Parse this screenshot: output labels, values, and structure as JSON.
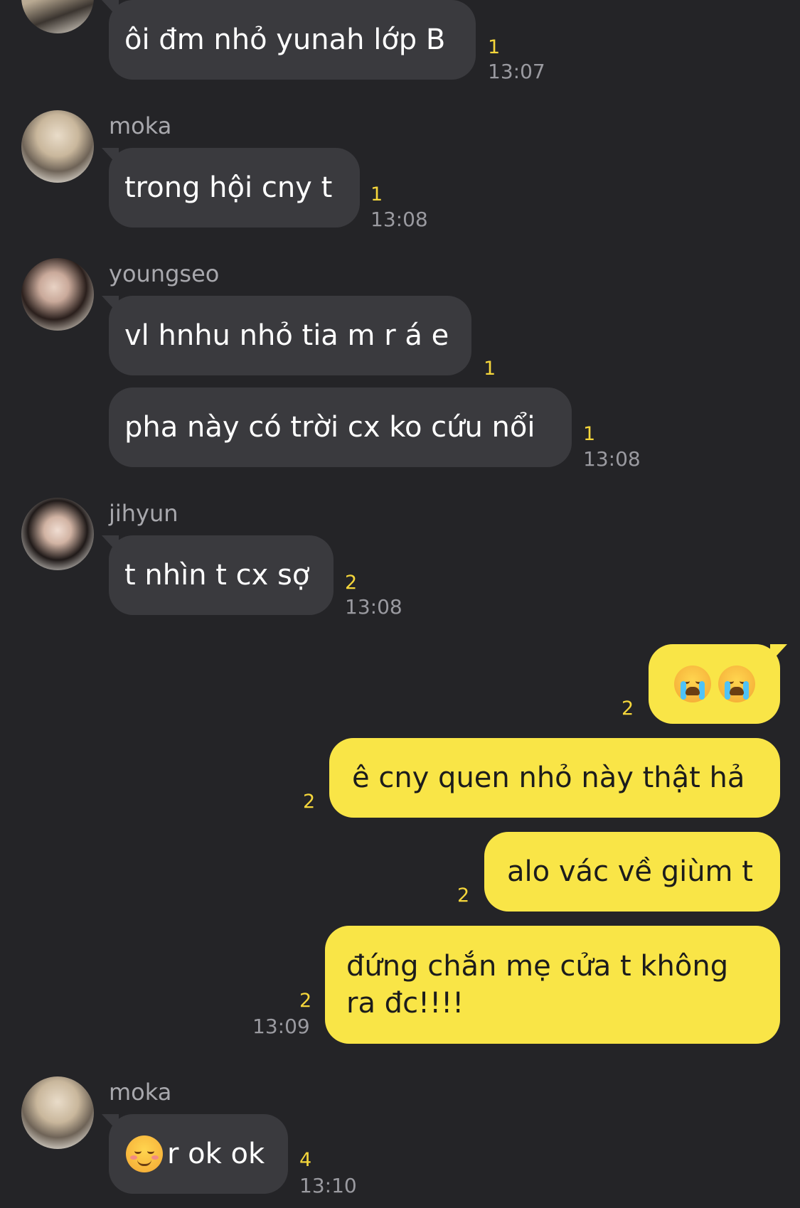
{
  "messages": [
    {
      "sender": "",
      "text": "ôi đm nhỏ yunah lớp B",
      "count": "1",
      "time": "13:07"
    },
    {
      "sender": "moka",
      "text": "trong hội cny t",
      "count": "1",
      "time": "13:08"
    },
    {
      "sender": "youngseo",
      "text": "vl hnhu nhỏ tia m r á e",
      "count": "1",
      "time": ""
    },
    {
      "sender": "",
      "text": "pha này có trời cx ko cứu nổi",
      "count": "1",
      "time": "13:08"
    },
    {
      "sender": "jihyun",
      "text": "t nhìn t cx sợ",
      "count": "2",
      "time": "13:08"
    },
    {
      "sender": "me",
      "text": "",
      "emoji": "loudly-crying-face-icon ×2",
      "count": "2",
      "time": ""
    },
    {
      "sender": "me",
      "text": "ê cny quen nhỏ này thật hả",
      "count": "2",
      "time": ""
    },
    {
      "sender": "me",
      "text": "alo vác về giùm t",
      "count": "2",
      "time": ""
    },
    {
      "sender": "me",
      "text_line1": "đứng chắn mẹ cửa t không",
      "text_line2": "ra đc!!!!",
      "count": "2",
      "time": "13:09"
    },
    {
      "sender": "moka",
      "text": "r ok ok",
      "emoji": "smiling-face-icon",
      "count": "4",
      "time": "13:10"
    }
  ],
  "colors": {
    "background": "#242427",
    "incoming_bubble": "#3a3a3e",
    "outgoing_bubble": "#f9e547",
    "unread_count": "#f5d63b",
    "timestamp": "#9a9aa0"
  }
}
